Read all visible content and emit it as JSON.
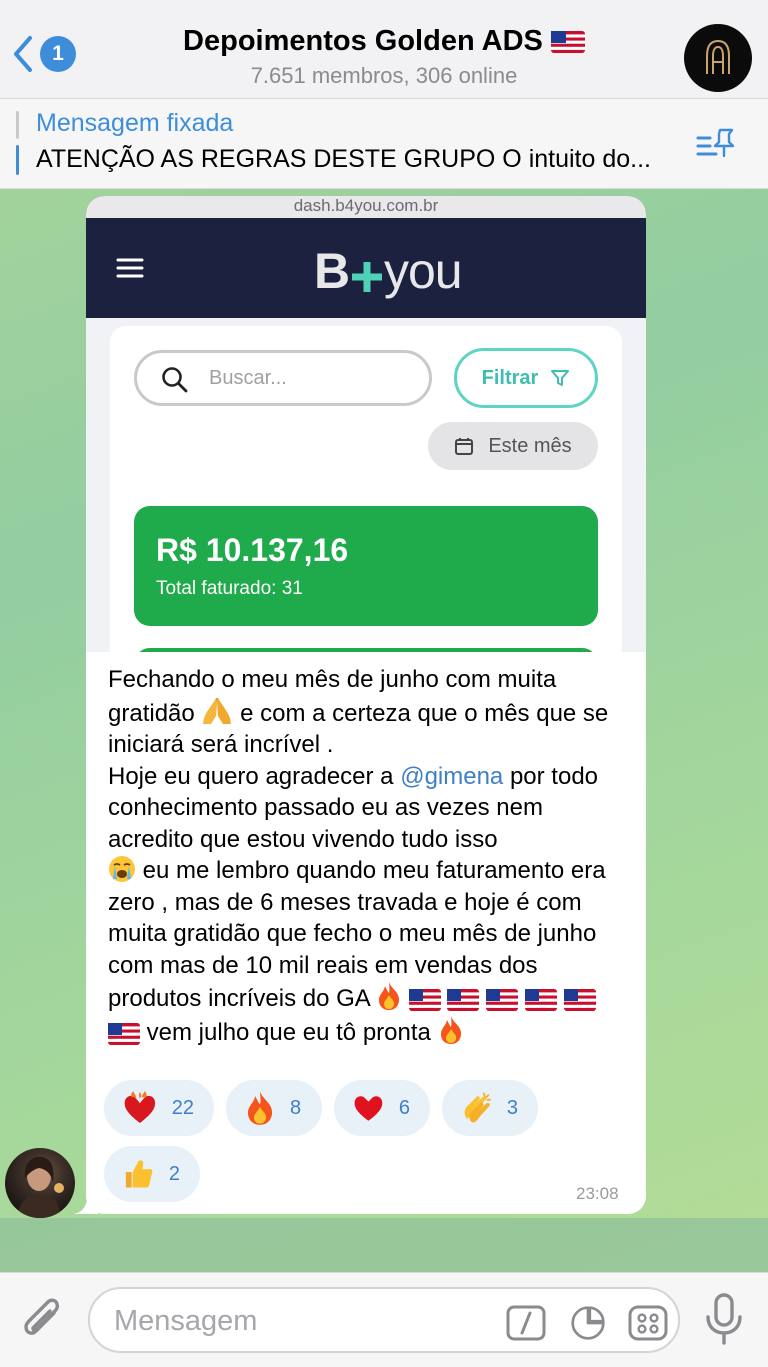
{
  "header": {
    "unread_count": "1",
    "title": "Depoimentos Golden ADS",
    "subtitle": "7.651 membros, 306 online"
  },
  "pinned": {
    "label": "Mensagem fixada",
    "text": "ATENÇÃO AS REGRAS DESTE GRUPO O intuito do..."
  },
  "message": {
    "screenshot": {
      "url": "dash.b4you.com.br",
      "logo_b": "B",
      "logo_you": "you",
      "search_placeholder": "Buscar...",
      "filter_label": "Filtrar",
      "period_label": "Este mês",
      "total_value": "R$ 10.137,16",
      "total_label": "Total faturado: 31"
    },
    "text": {
      "p1": "Fechando o meu mês de junho com muita gratidão",
      "p2": "e com a certeza que o mês que se iniciará será incrível .",
      "p3": "Hoje eu quero agradecer a",
      "mention": "@gimena",
      "p4": "por todo conhecimento passado eu as vezes nem acredito que estou vivendo tudo isso",
      "p5": "eu me lembro quando meu faturamento era zero , mas de 6 meses travada e hoje é com muita gratidão que fecho o meu mês de junho com mas de 10 mil reais em vendas dos produtos incríveis do GA",
      "p6": "vem julho que eu tô pronta"
    },
    "reactions": [
      {
        "icon": "heart-on-fire-icon",
        "count": "22"
      },
      {
        "icon": "fire-icon",
        "count": "8"
      },
      {
        "icon": "red-heart-icon",
        "count": "6"
      },
      {
        "icon": "clapping-hands-icon",
        "count": "3"
      },
      {
        "icon": "thumbs-up-icon",
        "count": "2"
      }
    ],
    "time": "23:08"
  },
  "composer": {
    "placeholder": "Mensagem"
  },
  "colors": {
    "accent": "#3d8ddb",
    "green_card": "#1faa4b",
    "filter_teal": "#5fd3c4",
    "nav_navy": "#1c2140"
  }
}
